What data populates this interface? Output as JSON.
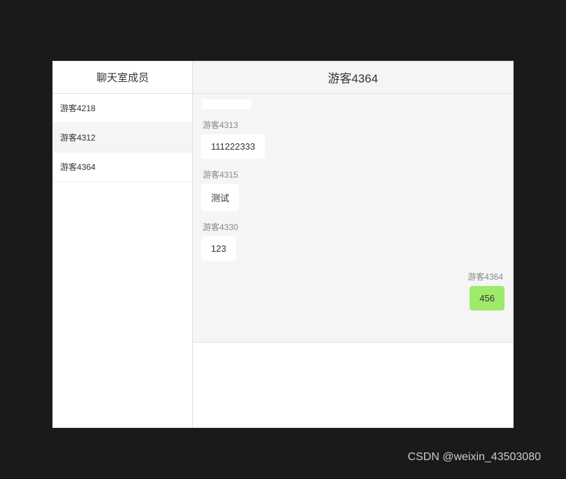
{
  "sidebar": {
    "title": "聊天室成员",
    "members": [
      {
        "name": "游客4218"
      },
      {
        "name": "游客4312"
      },
      {
        "name": "游客4364"
      }
    ]
  },
  "header": {
    "current_user": "游客4364"
  },
  "messages": [
    {
      "sender": "游客4313",
      "text": "111222333",
      "side": "left"
    },
    {
      "sender": "游客4315",
      "text": "测试",
      "side": "left"
    },
    {
      "sender": "游客4330",
      "text": "123",
      "side": "left"
    },
    {
      "sender": "游客4364",
      "text": "456",
      "side": "right"
    }
  ],
  "watermark": "CSDN @weixin_43503080"
}
